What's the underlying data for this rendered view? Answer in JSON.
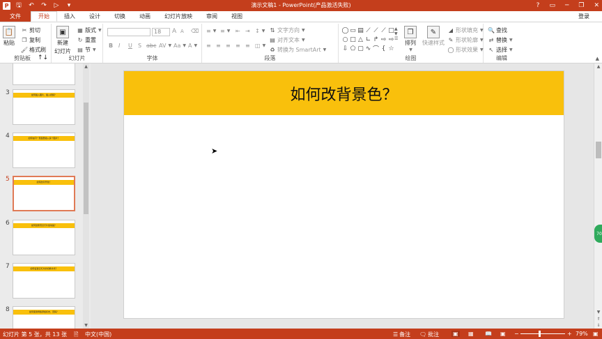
{
  "titlebar": {
    "title": "演示文稿1 - PowerPoint(产品激活失败)",
    "app_logo": "P",
    "qat_icons": [
      "save-icon",
      "undo-icon",
      "redo-icon",
      "start-from-beginning-icon",
      "customize-qat-icon"
    ],
    "help": "?",
    "ribbon_display": "▭",
    "minimize": "─",
    "restore": "❐",
    "close": "✕"
  },
  "tabs": [
    {
      "label": "文件"
    },
    {
      "label": "开始"
    },
    {
      "label": "插入"
    },
    {
      "label": "设计"
    },
    {
      "label": "切换"
    },
    {
      "label": "动画"
    },
    {
      "label": "幻灯片放映"
    },
    {
      "label": "审阅"
    },
    {
      "label": "视图"
    }
  ],
  "login": "登录",
  "ribbon": {
    "clipboard": {
      "label": "剪贴板",
      "paste": "粘贴",
      "cut": "剪切",
      "copy": "复制",
      "format_painter": "格式刷"
    },
    "slides": {
      "label": "幻灯片",
      "new_slide_line1": "新建",
      "new_slide_line2": "幻灯片",
      "layout": "版式",
      "reset": "重置",
      "section": "节"
    },
    "font": {
      "label": "字体",
      "font_size": "18",
      "bold": "B",
      "italic": "I",
      "underline": "U",
      "strike": "S",
      "spacing": "AV",
      "case": "Aa",
      "color": "A",
      "grow": "A",
      "shrink": "A"
    },
    "paragraph": {
      "label": "段落",
      "text_direction": "文字方向",
      "align_text": "对齐文本",
      "convert_smartart": "转换为 SmartArt"
    },
    "drawing": {
      "label": "绘图",
      "arrange": "排列",
      "quick_styles": "快速样式",
      "shape_fill": "形状填充",
      "shape_outline": "形状轮廓",
      "shape_effects": "形状效果"
    },
    "editing": {
      "label": "编辑",
      "find": "查找",
      "replace": "替换",
      "select": "选择"
    }
  },
  "thumbnails": [
    {
      "num": "3",
      "caption": "如何插入图片、插入视频？"
    },
    {
      "num": "4",
      "caption": "如何在同一页面里插入多个图片？"
    },
    {
      "num": "5",
      "caption": "如何改背景色？"
    },
    {
      "num": "6",
      "caption": "如何给整页幻灯片加动画？"
    },
    {
      "num": "7",
      "caption": "如何设置幻灯片的切换方式？"
    },
    {
      "num": "8",
      "caption": "如何使用母版添加标志、页码？"
    }
  ],
  "slide": {
    "title": "如何改背景色？",
    "band_color": "#f9c00c"
  },
  "status": {
    "slide_info": "幻灯片 第 5 张，共 13 张",
    "language": "中文(中国)",
    "notes": "备注",
    "comments": "批注",
    "zoom_minus": "−",
    "zoom_plus": "+",
    "zoom": "79%"
  },
  "float_widget": "70"
}
